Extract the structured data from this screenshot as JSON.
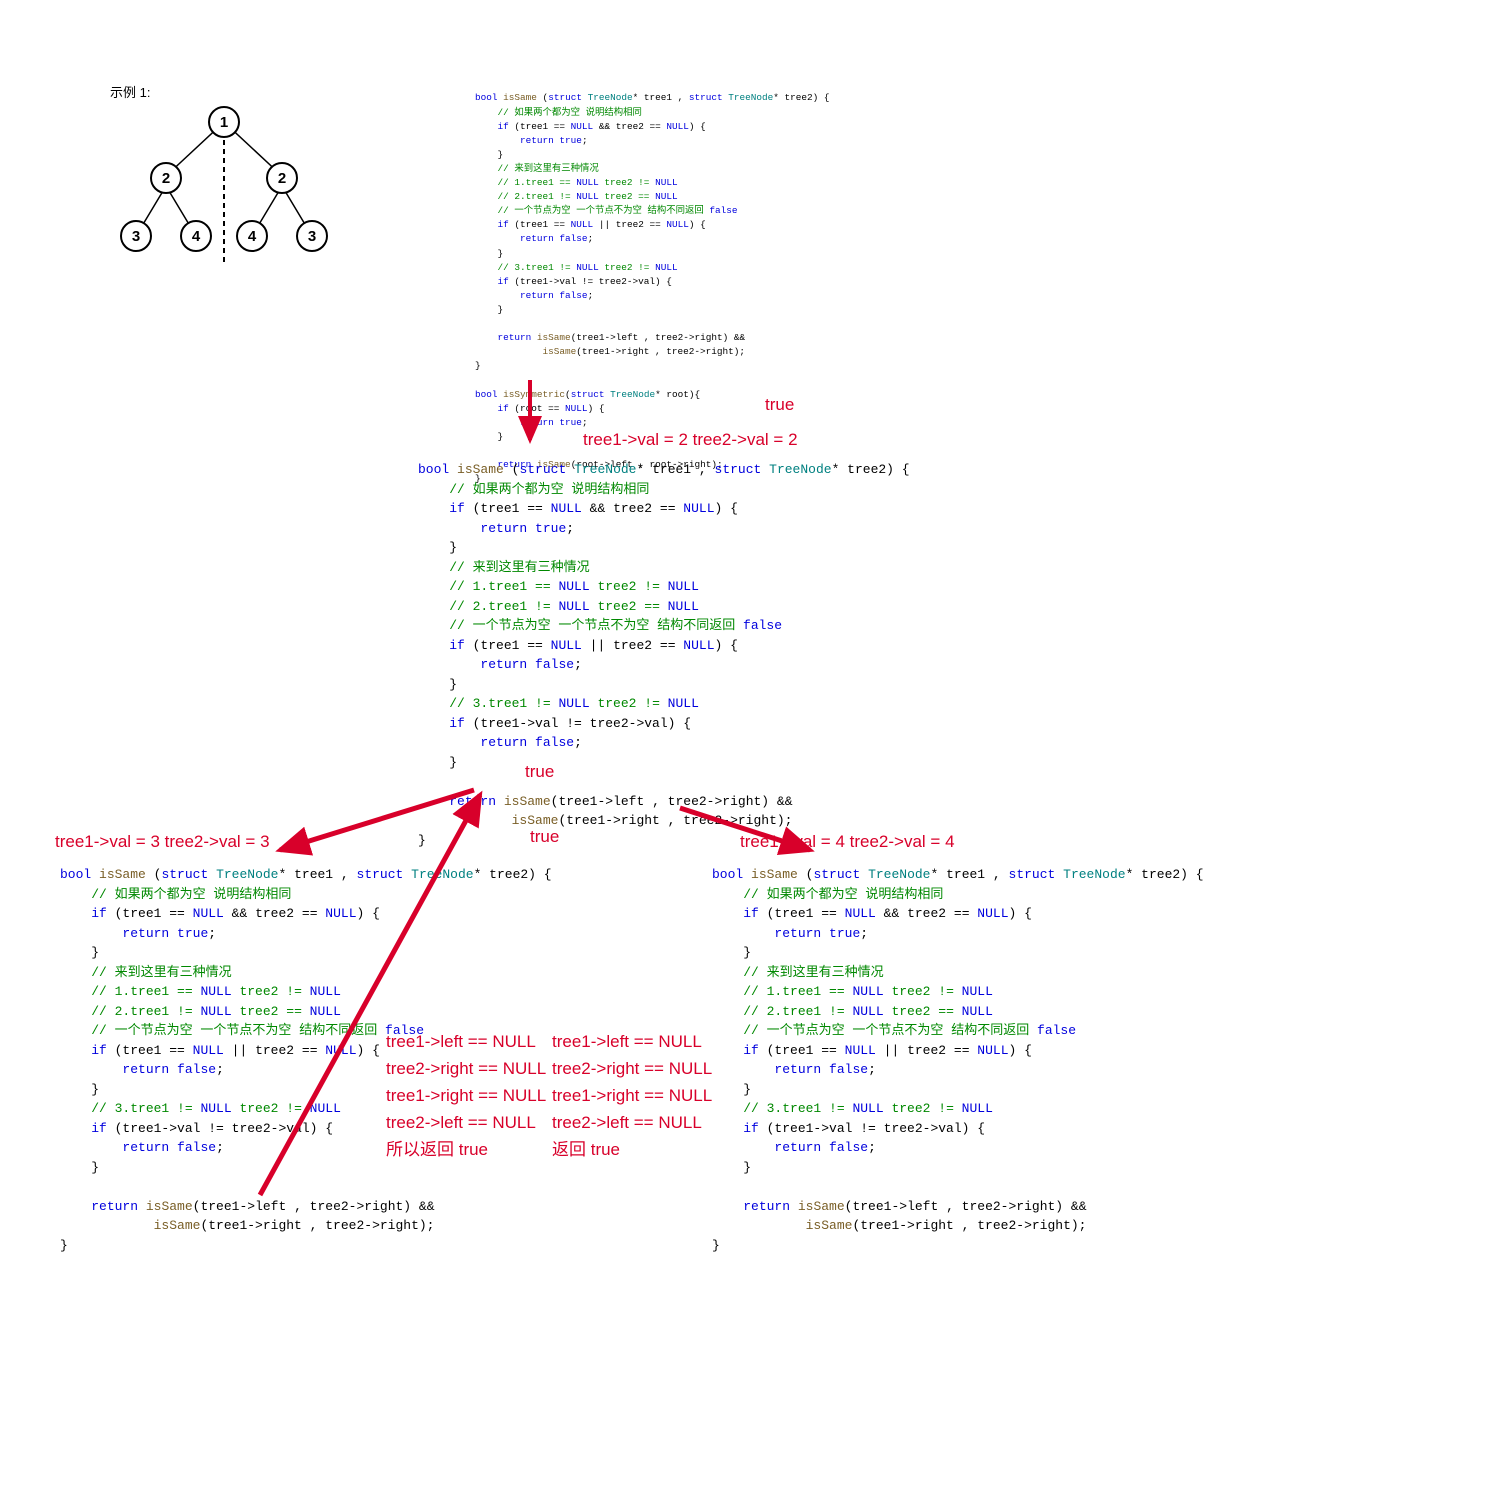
{
  "example_label": "示例 1:",
  "tree": {
    "nodes": [
      "1",
      "2",
      "2",
      "3",
      "4",
      "4",
      "3"
    ]
  },
  "code_small_top": "bool isSame (struct TreeNode* tree1 , struct TreeNode* tree2) {\n    // 如果两个都为空 说明结构相同\n    if (tree1 == NULL && tree2 == NULL) {\n        return true;\n    }\n    // 来到这里有三种情况\n    // 1.tree1 == NULL tree2 != NULL\n    // 2.tree1 != NULL tree2 == NULL\n    // 一个节点为空 一个节点不为空 结构不同返回 false\n    if (tree1 == NULL || tree2 == NULL) {\n        return false;\n    }\n    // 3.tree1 != NULL tree2 != NULL\n    if (tree1->val != tree2->val) {\n        return false;\n    }\n\n    return isSame(tree1->left , tree2->right) &&\n            isSame(tree1->right , tree2->right);\n}\n\nbool isSymmetric(struct TreeNode* root){\n    if (root == NULL) {\n        return true;\n    }\n\n    return isSame(root->left , root->right);\n}",
  "code_medium": "bool isSame (struct TreeNode* tree1 , struct TreeNode* tree2) {\n    // 如果两个都为空 说明结构相同\n    if (tree1 == NULL && tree2 == NULL) {\n        return true;\n    }\n    // 来到这里有三种情况\n    // 1.tree1 == NULL tree2 != NULL\n    // 2.tree1 != NULL tree2 == NULL\n    // 一个节点为空 一个节点不为空 结构不同返回 false\n    if (tree1 == NULL || tree2 == NULL) {\n        return false;\n    }\n    // 3.tree1 != NULL tree2 != NULL\n    if (tree1->val != tree2->val) {\n        return false;\n    }\n\n    return isSame(tree1->left , tree2->right) &&\n            isSame(tree1->right , tree2->right);\n}",
  "code_left": "bool isSame (struct TreeNode* tree1 , struct TreeNode* tree2) {\n    // 如果两个都为空 说明结构相同\n    if (tree1 == NULL && tree2 == NULL) {\n        return true;\n    }\n    // 来到这里有三种情况\n    // 1.tree1 == NULL tree2 != NULL\n    // 2.tree1 != NULL tree2 == NULL\n    // 一个节点为空 一个节点不为空 结构不同返回 false\n    if (tree1 == NULL || tree2 == NULL) {\n        return false;\n    }\n    // 3.tree1 != NULL tree2 != NULL\n    if (tree1->val != tree2->val) {\n        return false;\n    }\n\n    return isSame(tree1->left , tree2->right) &&\n            isSame(tree1->right , tree2->right);\n}",
  "code_right": "bool isSame (struct TreeNode* tree1 , struct TreeNode* tree2) {\n    // 如果两个都为空 说明结构相同\n    if (tree1 == NULL && tree2 == NULL) {\n        return true;\n    }\n    // 来到这里有三种情况\n    // 1.tree1 == NULL tree2 != NULL\n    // 2.tree1 != NULL tree2 == NULL\n    // 一个节点为空 一个节点不为空 结构不同返回 false\n    if (tree1 == NULL || tree2 == NULL) {\n        return false;\n    }\n    // 3.tree1 != NULL tree2 != NULL\n    if (tree1->val != tree2->val) {\n        return false;\n    }\n\n    return isSame(tree1->left , tree2->right) &&\n            isSame(tree1->right , tree2->right);\n}",
  "annotations": {
    "true_top_right": "true",
    "tree_vals_2": "tree1->val = 2   tree2->val = 2",
    "true_mid1": "true",
    "true_mid2": "true",
    "left_vals_3": "tree1->val = 3   tree2->val = 3",
    "right_vals_4": "tree1->val = 4   tree2->val = 4",
    "left_block": "tree1->left == NULL\ntree2->right == NULL\ntree1->right == NULL\ntree2->left == NULL\n所以返回 true",
    "right_block": "tree1->left == NULL\ntree2->right == NULL\ntree1->right == NULL\ntree2->left == NULL\n返回 true"
  }
}
